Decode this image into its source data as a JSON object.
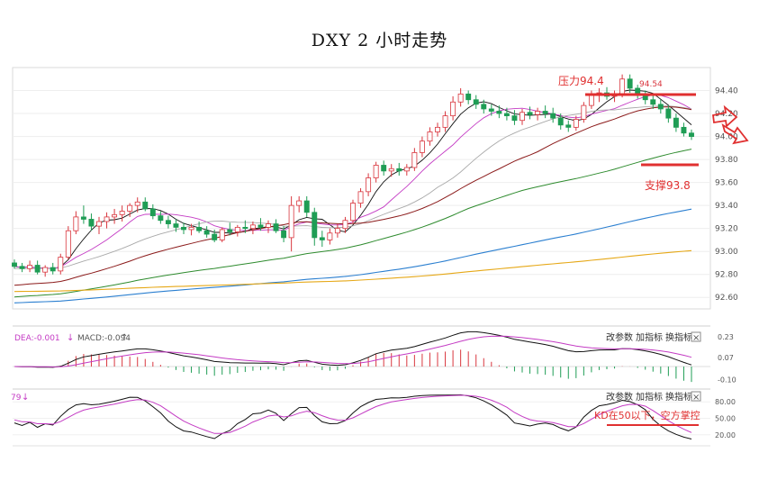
{
  "title": "DXY 2 小时走势",
  "colors": {
    "up": "#d9363e",
    "down": "#1f9d55",
    "dif": "#111111",
    "dea": "#c43bc4",
    "ma5": "#111111",
    "ma10": "#c43bc4",
    "ma20": "#a9a9a9",
    "ma30": "#8b1a1a",
    "ma60": "#2e8b2e",
    "ma120": "#2b7fd0",
    "ma250": "#e6a817",
    "annotation": "#e03030"
  },
  "main_panel": {
    "price_axis_ticks": [
      "94.40",
      "94.20",
      "94.00",
      "93.80",
      "93.60",
      "93.40",
      "93.20",
      "93.00",
      "92.80",
      "92.60"
    ],
    "resistance_label": "压力94.4",
    "support_label": "支撑93.8",
    "high_marker": "94.54"
  },
  "macd_panel": {
    "header_dea": "DEA:-0.001",
    "header_macd": "MACD:-0.094",
    "axis_ticks": [
      "0.23",
      "0.07",
      "-0.10"
    ]
  },
  "kd_panel": {
    "header": "79",
    "annotation": "KD在50以下，空方掌控",
    "axis_ticks": [
      "80.00",
      "50.00",
      "20.00"
    ]
  },
  "toolbar": {
    "params": "改参数",
    "add": "加指标",
    "swap": "换指标",
    "close": "×"
  },
  "chart_data": [
    {
      "type": "candlestick",
      "title": "DXY 2 小时走势",
      "ylim": [
        92.5,
        94.6
      ],
      "candles": [
        [
          92.9,
          92.93,
          92.85,
          92.87
        ],
        [
          92.87,
          92.9,
          92.82,
          92.85
        ],
        [
          92.85,
          92.92,
          92.82,
          92.88
        ],
        [
          92.88,
          92.92,
          92.8,
          92.82
        ],
        [
          92.82,
          92.88,
          92.78,
          92.86
        ],
        [
          92.86,
          92.9,
          92.8,
          92.83
        ],
        [
          92.83,
          92.98,
          92.8,
          92.95
        ],
        [
          92.95,
          93.22,
          92.93,
          93.18
        ],
        [
          93.18,
          93.35,
          93.15,
          93.3
        ],
        [
          93.3,
          93.4,
          93.24,
          93.28
        ],
        [
          93.28,
          93.33,
          93.18,
          93.22
        ],
        [
          93.22,
          93.3,
          93.15,
          93.26
        ],
        [
          93.26,
          93.34,
          93.2,
          93.3
        ],
        [
          93.3,
          93.37,
          93.24,
          93.32
        ],
        [
          93.32,
          93.4,
          93.26,
          93.35
        ],
        [
          93.35,
          93.42,
          93.3,
          93.4
        ],
        [
          93.4,
          93.47,
          93.34,
          93.43
        ],
        [
          93.43,
          93.47,
          93.35,
          93.37
        ],
        [
          93.37,
          93.41,
          93.28,
          93.31
        ],
        [
          93.31,
          93.35,
          93.24,
          93.27
        ],
        [
          93.27,
          93.31,
          93.2,
          93.24
        ],
        [
          93.24,
          93.28,
          93.17,
          93.21
        ],
        [
          93.21,
          93.25,
          93.15,
          93.19
        ],
        [
          93.19,
          93.24,
          93.14,
          93.21
        ],
        [
          93.21,
          93.26,
          93.16,
          93.18
        ],
        [
          93.18,
          93.22,
          93.12,
          93.15
        ],
        [
          93.15,
          93.19,
          93.08,
          93.1
        ],
        [
          93.1,
          93.21,
          93.08,
          93.19
        ],
        [
          93.19,
          93.25,
          93.14,
          93.17
        ],
        [
          93.17,
          93.23,
          93.13,
          93.21
        ],
        [
          93.21,
          93.27,
          93.16,
          93.2
        ],
        [
          93.2,
          93.26,
          93.15,
          93.23
        ],
        [
          93.23,
          93.29,
          93.18,
          93.21
        ],
        [
          93.21,
          93.27,
          93.16,
          93.24
        ],
        [
          93.24,
          93.28,
          93.16,
          93.18
        ],
        [
          93.18,
          93.22,
          93.08,
          93.12
        ],
        [
          93.12,
          93.48,
          93.0,
          93.4
        ],
        [
          93.4,
          93.48,
          93.34,
          93.44
        ],
        [
          93.44,
          93.48,
          93.3,
          93.34
        ],
        [
          93.34,
          93.38,
          93.05,
          93.12
        ],
        [
          93.12,
          93.18,
          93.04,
          93.1
        ],
        [
          93.1,
          93.2,
          93.06,
          93.16
        ],
        [
          93.16,
          93.24,
          93.12,
          93.2
        ],
        [
          93.2,
          93.3,
          93.16,
          93.27
        ],
        [
          93.27,
          93.45,
          93.24,
          93.42
        ],
        [
          93.42,
          93.55,
          93.38,
          93.52
        ],
        [
          93.52,
          93.68,
          93.48,
          93.64
        ],
        [
          93.64,
          93.78,
          93.6,
          93.75
        ],
        [
          93.75,
          93.79,
          93.66,
          93.7
        ],
        [
          93.7,
          93.76,
          93.65,
          93.72
        ],
        [
          93.72,
          93.77,
          93.66,
          93.7
        ],
        [
          93.7,
          93.76,
          93.66,
          93.73
        ],
        [
          93.73,
          93.9,
          93.7,
          93.86
        ],
        [
          93.86,
          94.0,
          93.82,
          93.96
        ],
        [
          93.96,
          94.08,
          93.92,
          94.04
        ],
        [
          94.04,
          94.12,
          94.0,
          94.08
        ],
        [
          94.08,
          94.22,
          94.04,
          94.18
        ],
        [
          94.18,
          94.35,
          94.14,
          94.3
        ],
        [
          94.3,
          94.42,
          94.26,
          94.37
        ],
        [
          94.37,
          94.4,
          94.28,
          94.32
        ],
        [
          94.32,
          94.36,
          94.24,
          94.28
        ],
        [
          94.28,
          94.32,
          94.2,
          94.24
        ],
        [
          94.24,
          94.28,
          94.18,
          94.22
        ],
        [
          94.22,
          94.27,
          94.16,
          94.2
        ],
        [
          94.2,
          94.25,
          94.14,
          94.18
        ],
        [
          94.18,
          94.23,
          94.1,
          94.14
        ],
        [
          94.14,
          94.24,
          94.1,
          94.21
        ],
        [
          94.21,
          94.26,
          94.15,
          94.19
        ],
        [
          94.19,
          94.25,
          94.14,
          94.22
        ],
        [
          94.22,
          94.27,
          94.16,
          94.2
        ],
        [
          94.2,
          94.25,
          94.12,
          94.16
        ],
        [
          94.16,
          94.2,
          94.06,
          94.1
        ],
        [
          94.1,
          94.14,
          94.04,
          94.08
        ],
        [
          94.08,
          94.18,
          94.05,
          94.15
        ],
        [
          94.15,
          94.3,
          94.12,
          94.27
        ],
        [
          94.27,
          94.4,
          94.24,
          94.36
        ],
        [
          94.36,
          94.42,
          94.3,
          94.38
        ],
        [
          94.38,
          94.43,
          94.32,
          94.35
        ],
        [
          94.35,
          94.4,
          94.3,
          94.37
        ],
        [
          94.37,
          94.54,
          94.34,
          94.5
        ],
        [
          94.5,
          94.54,
          94.38,
          94.42
        ],
        [
          94.42,
          94.45,
          94.33,
          94.36
        ],
        [
          94.36,
          94.4,
          94.28,
          94.32
        ],
        [
          94.32,
          94.36,
          94.24,
          94.28
        ],
        [
          94.28,
          94.32,
          94.2,
          94.24
        ],
        [
          94.24,
          94.27,
          94.12,
          94.16
        ],
        [
          94.16,
          94.2,
          94.04,
          94.08
        ],
        [
          94.08,
          94.12,
          94.0,
          94.03
        ],
        [
          94.03,
          94.06,
          93.97,
          94.0
        ]
      ],
      "moving_averages": [
        "MA5",
        "MA10",
        "MA20",
        "MA30",
        "MA60",
        "MA120",
        "MA250"
      ],
      "levels": {
        "resistance": 94.4,
        "support": 93.8
      },
      "yticks": [
        94.4,
        94.2,
        94.0,
        93.8,
        93.6,
        93.4,
        93.2,
        93.0,
        92.8,
        92.6
      ]
    },
    {
      "type": "macd",
      "ylim": [
        -0.16,
        0.3
      ],
      "yticks": [
        0.23,
        0.07,
        -0.1
      ],
      "dea_current": -0.001,
      "macd_current": -0.094
    },
    {
      "type": "kd",
      "ylim": [
        0,
        100
      ],
      "yticks": [
        80,
        50,
        20
      ]
    }
  ]
}
